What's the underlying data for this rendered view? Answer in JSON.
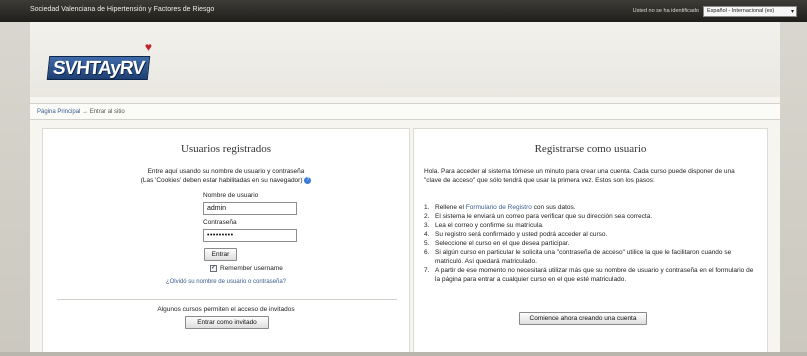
{
  "topbar": {
    "site_name": "Sociedad Valenciana de Hipertensión y Factores de Riesgo",
    "login_info": "Usted no se ha identificado",
    "language": "Español - Internacional (es)"
  },
  "logo": {
    "text": "SVHTAyRV",
    "heart": "♥"
  },
  "breadcrumb": {
    "home": "Página Principal",
    "separator": "→",
    "current": "Entrar al sitio"
  },
  "login": {
    "title": "Usuarios registrados",
    "instruction1": "Entre aquí usando su nombre de usuario y contraseña",
    "instruction2": "(Las 'Cookies' deben estar habilitadas en su navegador)",
    "help_icon": "?",
    "username_label": "Nombre de usuario",
    "username_value": "admin",
    "password_label": "Contraseña",
    "password_value": "•••••••••",
    "submit_label": "Entrar",
    "remember_label": "Remember username",
    "remember_checked": "✓",
    "forgot_link": "¿Olvidó su nombre de usuario o contraseña?",
    "guest_text": "Algunos cursos permiten el acceso de invitados",
    "guest_button": "Entrar como invitado"
  },
  "signup": {
    "title": "Registrarse como usuario",
    "intro": "Hola. Para acceder al sistema tómese un minuto para crear una cuenta. Cada curso puede disponer de una \"clave de acceso\" que sólo tendrá que usar la primera vez. Estos son los pasos:",
    "step1_num": "1.",
    "step1_pre": "Rellene el",
    "step1_link": "Formulario de Registro",
    "step1_post": "con sus datos.",
    "steps": [
      {
        "num": "2.",
        "text": "El sistema le enviará un correo para verificar que su dirección sea correcta."
      },
      {
        "num": "3.",
        "text": "Lea el correo y confirme su matrícula."
      },
      {
        "num": "4.",
        "text": "Su registro será confirmado y usted podrá acceder al curso."
      },
      {
        "num": "5.",
        "text": "Seleccione el curso en el que desea participar."
      },
      {
        "num": "6.",
        "text": "Si algún curso en particular le solicita una \"contraseña de acceso\" utilice la que le facilitaron cuando se matriculó. Así quedará matriculado."
      },
      {
        "num": "7.",
        "text": "A partir de ese momento no necesitará utilizar más que su nombre de usuario y contraseña en el formulario de la página para entrar a cualquier curso en el que esté matriculado."
      }
    ],
    "button_label": "Comience ahora creando una cuenta"
  }
}
